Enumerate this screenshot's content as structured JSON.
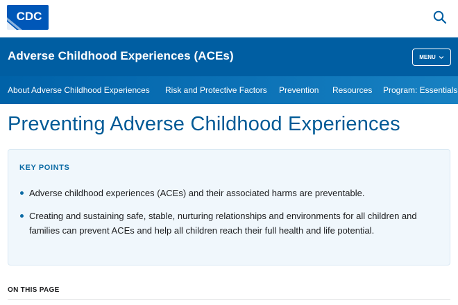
{
  "header": {
    "logo_text": "CDC",
    "brand_color": "#005ea2",
    "search_icon": "search-icon"
  },
  "banner": {
    "title": "Adverse Childhood Experiences (ACEs)",
    "menu_label": "MENU",
    "menu_icon": "chevron-down-icon"
  },
  "subnav": {
    "items": [
      {
        "label": "About Adverse Childhood Experiences"
      },
      {
        "label": "Risk and Protective Factors"
      },
      {
        "label": "Prevention"
      },
      {
        "label": "Resources"
      },
      {
        "label": "Program: Essentials"
      }
    ]
  },
  "main": {
    "title": "Preventing Adverse Childhood Experiences",
    "key_points": {
      "heading": "KEY POINTS",
      "items": [
        "Adverse childhood experiences (ACEs) and their associated harms are preventable.",
        "Creating and sustaining safe, stable, nurturing relationships and environments for all children and families can prevent ACEs and help all children reach their full health and life potential."
      ]
    },
    "on_this_page": "ON THIS PAGE"
  }
}
